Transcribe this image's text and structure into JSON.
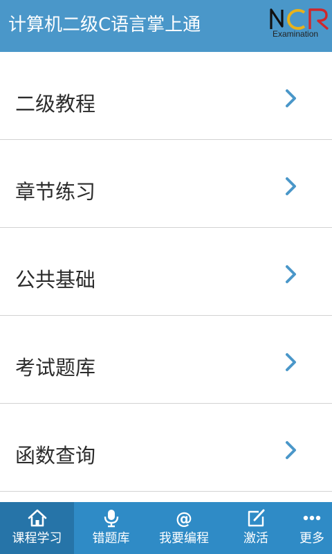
{
  "header": {
    "title": "计算机二级C语言掌上通",
    "logo_text": "NCR",
    "logo_sub": "Examination",
    "color": "#4a97c9"
  },
  "menu": {
    "items": [
      {
        "label": "二级教程"
      },
      {
        "label": "章节练习"
      },
      {
        "label": "公共基础"
      },
      {
        "label": "考试题库"
      },
      {
        "label": "函数查询"
      }
    ],
    "chevron_color": "#4a97c9"
  },
  "tabbar": {
    "color": "#2f8bc6",
    "active_color": "#2674a8",
    "tabs": [
      {
        "label": "课程学习",
        "icon": "home-icon",
        "active": true
      },
      {
        "label": "错题库",
        "icon": "microphone-icon",
        "active": false
      },
      {
        "label": "我要编程",
        "icon": "at-sign-icon",
        "active": false
      },
      {
        "label": "激活",
        "icon": "edit-icon",
        "active": false
      },
      {
        "label": "更多",
        "icon": "more-icon",
        "active": false
      }
    ]
  }
}
